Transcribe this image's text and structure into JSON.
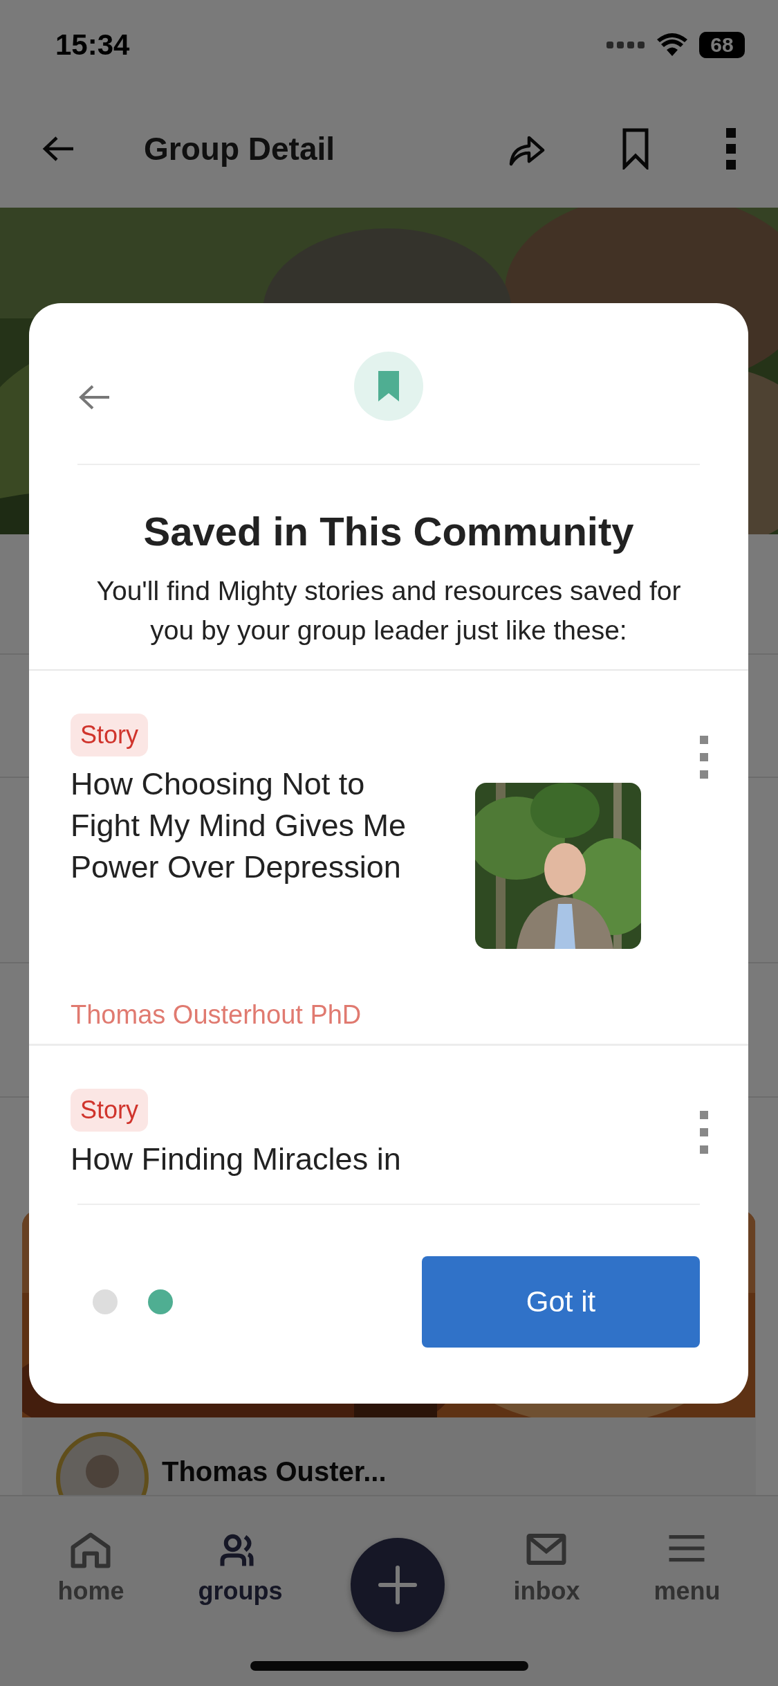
{
  "status_bar": {
    "time": "15:34",
    "battery": "68"
  },
  "app_bar": {
    "title": "Group Detail"
  },
  "background_post": {
    "author": "Thomas Ouster..."
  },
  "modal": {
    "title": "Saved in This Community",
    "description": "You'll find Mighty stories and resources saved for you by your group leader just like these:",
    "items": [
      {
        "tag": "Story",
        "title": "How Choosing Not to Fight My Mind Gives Me Power Over Depression",
        "author": "Thomas Ousterhout PhD"
      },
      {
        "tag": "Story",
        "title": "How Finding Miracles in"
      }
    ],
    "pages": [
      {
        "selected": false
      },
      {
        "selected": true
      }
    ],
    "button": "Got it"
  },
  "nav": {
    "items": [
      {
        "kind": "tab",
        "label": "home",
        "selected": false
      },
      {
        "kind": "tab",
        "label": "groups",
        "selected": true
      },
      {
        "kind": "fab"
      },
      {
        "kind": "tab",
        "label": "inbox",
        "selected": false
      },
      {
        "kind": "tab",
        "label": "menu",
        "selected": false
      }
    ]
  }
}
